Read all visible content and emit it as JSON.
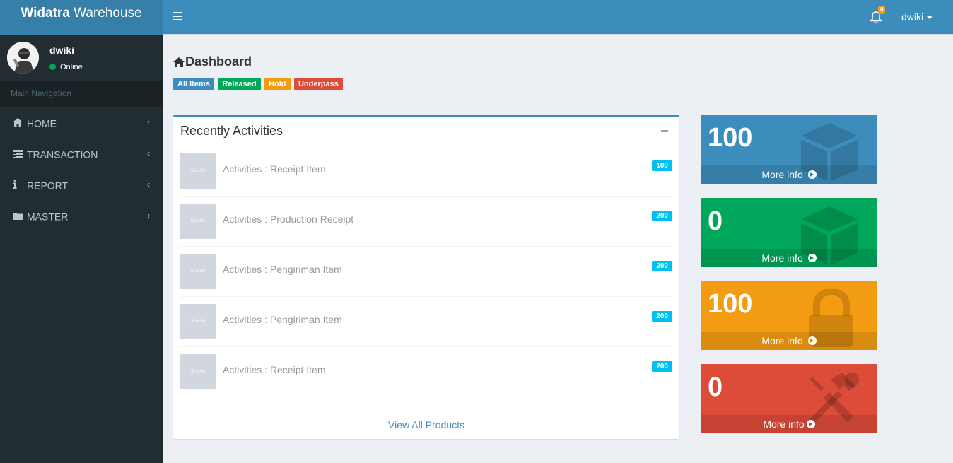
{
  "app": {
    "logo_bold": "Widatra",
    "logo_rest": " Warehouse"
  },
  "navbar": {
    "notification_count": "0",
    "user_name": "dwiki"
  },
  "sidebar": {
    "user_name": "dwiki",
    "user_status": "Online",
    "nav_header": "Main Navigation",
    "items": [
      {
        "label": "HOME",
        "icon": "home-icon"
      },
      {
        "label": "TRANSACTION",
        "icon": "tasks-icon"
      },
      {
        "label": "REPORT",
        "icon": "info-icon"
      },
      {
        "label": "MASTER",
        "icon": "folder-icon"
      }
    ]
  },
  "page": {
    "title": "Dashboard",
    "labels": [
      {
        "text": "All Items",
        "color": "#3c8dbc"
      },
      {
        "text": "Released",
        "color": "#00a65a"
      },
      {
        "text": "Hold",
        "color": "#f39c12"
      },
      {
        "text": "Underpass",
        "color": "#dd4b39"
      }
    ]
  },
  "activities": {
    "title": "Recently Activities",
    "placeholder_text": "50 x 50",
    "items": [
      {
        "title": "Activities : Receipt Item",
        "badge": "100"
      },
      {
        "title": "Activities : Production Receipt",
        "badge": "200"
      },
      {
        "title": "Activities : Pengiriman Item",
        "badge": "200"
      },
      {
        "title": "Activities : Pengiriman Item",
        "badge": "200"
      },
      {
        "title": "Activities : Receipt Item",
        "badge": "200"
      }
    ],
    "footer_link": "View All Products"
  },
  "stat_boxes": [
    {
      "value": "100",
      "more": "More info",
      "color": "#3c8dbc",
      "icon": "cube-icon"
    },
    {
      "value": "0",
      "more": "More info",
      "color": "#00a65a",
      "icon": "cube-icon"
    },
    {
      "value": "100",
      "more": "More info",
      "color": "#f39c12",
      "icon": "lock-icon"
    },
    {
      "value": "0",
      "more": "More info",
      "color": "#dd4b39",
      "icon": "tools-icon"
    }
  ]
}
